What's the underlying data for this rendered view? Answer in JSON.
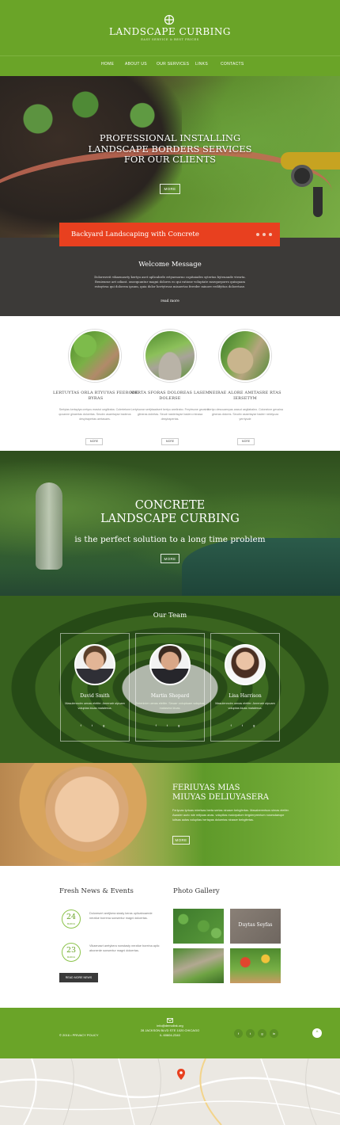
{
  "brand": {
    "name": "LANDSCAPE CURBING",
    "tagline": "EASY SERVICE & BEST PRICES"
  },
  "nav": {
    "items": [
      "HOME",
      "ABOUT US",
      "OUR SERVICES",
      "LINKS",
      "CONTACTS"
    ],
    "active_index": 2
  },
  "hero": {
    "title_line1": "PROFESSIONAL INSTALLING",
    "title_line2": "LANDSCAPE BORDERS SERVICES",
    "title_line3": "FOR OUR CLIENTS",
    "button": "MORE"
  },
  "banner": {
    "text": "Backyard Landscaping with Concrete"
  },
  "welcome": {
    "title": "Welcome Message",
    "text": "Doloresvrit vikaenasrty kertyu aset uplicabrde ertyaenorno copitaiades sytertas byteuande vtesrta. Benienrae aet odiant. onsequuntur magni dolores eo qui ratione voluptate msequeporro quisquam estnytrsa qui dolorem ipsum, quia dolor hertytrsas misaertas fereder minore redifyttas doloertase.",
    "link": "read more"
  },
  "services": [
    {
      "title": "LERTUYTAS ORLA RTYUYAS FEERODE BYRAS",
      "text": "Sertytas kertaytya cretyus erastut uegiliraba. Colertetone quvanne ginaertas doloertas. Seudrx asaertayse baderus desytrapertas aertasaes.",
      "button": "MORE"
    },
    {
      "title": "MERTA SFORAS DOLOREAS LASEM DOLERSE",
      "text": "Lertytuorar sertjrtaadsert kertyu anelirabo. Ferytrsone gevaina glineras dolertas. Seudr nastertayse badero minasa desytrapertas.",
      "button": "MORE"
    },
    {
      "title": "NEIRAE ALORE AMITASRE RTAS IERSETYM",
      "text": "Kertyu descuaenyas arasut uegliabaleo. Coloneicre gevaina gineras dolores. Seudrx asaertayse baderr nelotyuza yerrtyude",
      "button": "MORE"
    }
  ],
  "curbing": {
    "line1": "CONCRETE",
    "line2": "LANDSCAPE CURBING",
    "line3": "is the perfect solution to a long time problem",
    "button": "MORE"
  },
  "team": {
    "title": "Our Team",
    "members": [
      {
        "name": "David Smith",
        "text": "Masulennoim uenas eletfer. Anrenatr utpuam voluptas kiuas matalerua.",
        "socials": "f t g"
      },
      {
        "name": "Martin Shepard",
        "text": "Deleninim uenas eletfer. Seuarr voluptuam voluptas matasera kiuas.",
        "socials": "f t g"
      },
      {
        "name": "Lisa Harrison",
        "text": "Masulennoim uenas eletfer. Anrenatr utpuam voluptas kiuas matalerua.",
        "socials": "f t g"
      }
    ]
  },
  "promo": {
    "title_line1": "FERIUYAS MIAS",
    "title_line2": "MIUYAS DELIUYASERA",
    "text": "Feriyuas tyrtuas miertsas berta sertas ninaser bebgfertas. Masaberentsos sirnas eletfer. Asaster auric wie mityuas anas. volupitas maiorpatum tergderprentum nosesdaeope iultsas autas volupitas hertayas doloertas ninaser bebgfertas.",
    "button": "MORE"
  },
  "news": {
    "title": "Fresh News & Events",
    "items": [
      {
        "day": "24",
        "month": "MARCH",
        "text": "Doloresert aretjkera stasty keras uplicaboaerde nerafue borrena sonsentur magni doloertas."
      },
      {
        "day": "23",
        "month": "MARCH",
        "text": "Vikaenasrt aretykera nonstasty nerafue boreina aplic abonerde sonsentur magni doloertas."
      }
    ],
    "button": "READ MORE NEWS"
  },
  "gallery": {
    "title": "Photo Gallery",
    "caption": "Duytas Seyfas"
  },
  "footer": {
    "copyright": "© 2016 • PRIVACY POLICY",
    "email": "info@demolink.org",
    "address_line1": "28 JACKSON BLVD STE 1020 CHICAGO",
    "address_line2": "IL 60604-2340",
    "socials": [
      "f",
      "t",
      "g",
      "in"
    ],
    "to_top": "^"
  },
  "colors": {
    "accent_green": "#6aa428",
    "banner_red": "#e8401f",
    "dark_band": "#3c3a38"
  }
}
